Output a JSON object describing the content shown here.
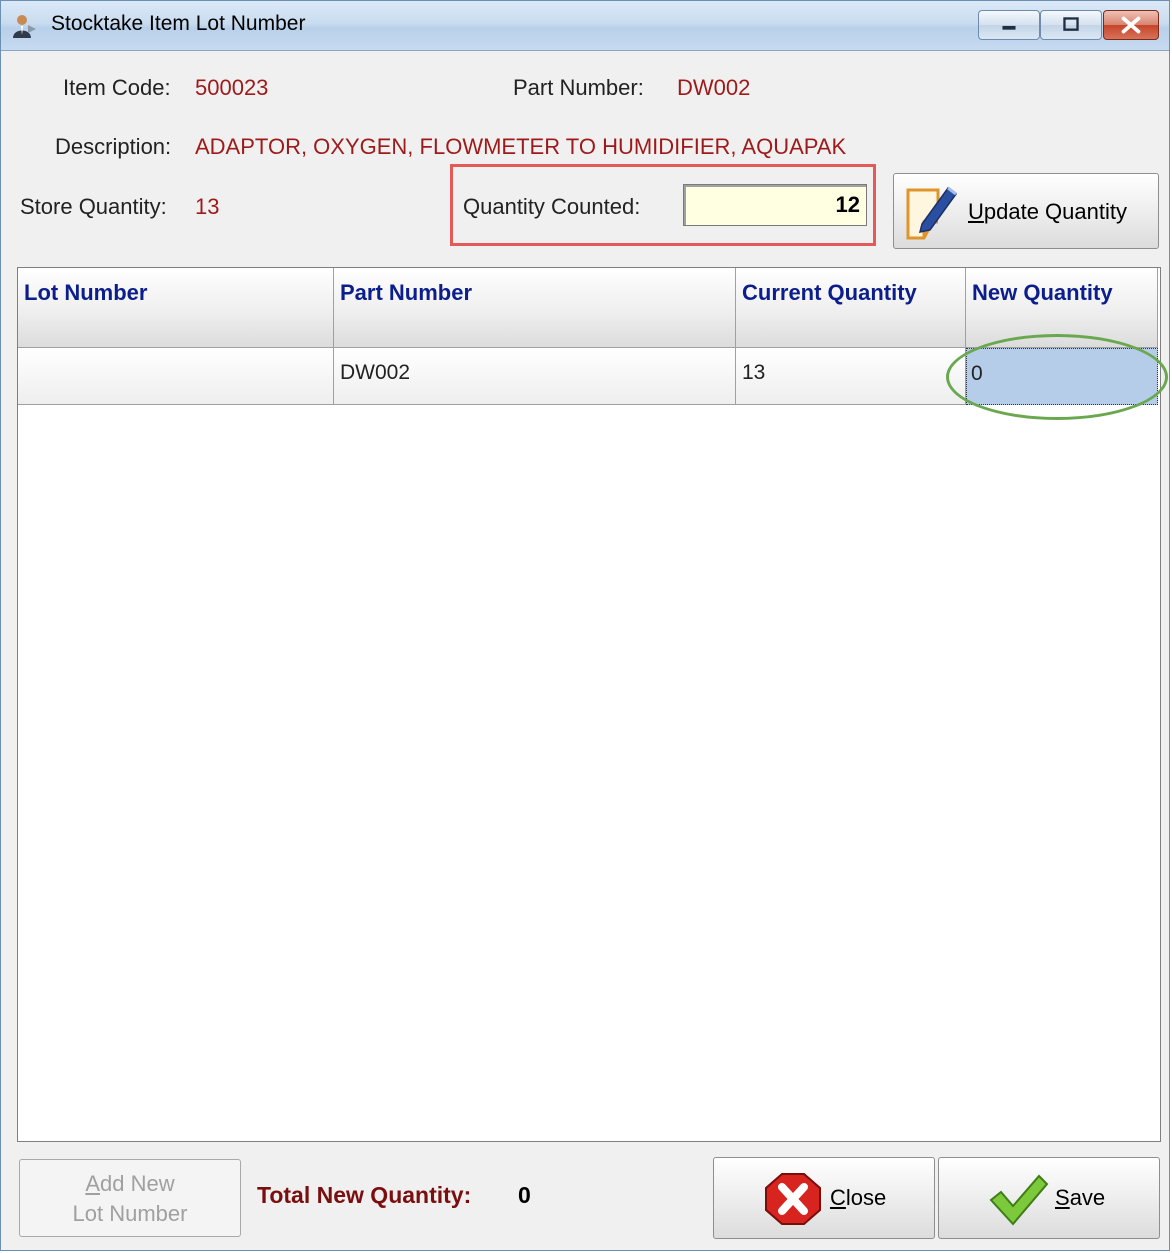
{
  "window": {
    "title": "Stocktake Item Lot Number"
  },
  "details": {
    "item_code_label": "Item Code:",
    "item_code_value": "500023",
    "part_number_label": "Part Number:",
    "part_number_value": "DW002",
    "description_label": "Description:",
    "description_value": "ADAPTOR, OXYGEN, FLOWMETER TO HUMIDIFIER, AQUAPAK",
    "store_quantity_label": "Store Quantity:",
    "store_quantity_value": "13",
    "quantity_counted_label": "Quantity Counted:",
    "quantity_counted_value": "12"
  },
  "update_button": {
    "label_first": "U",
    "label_rest": "pdate Quantity",
    "icon": "edit-note-icon"
  },
  "grid": {
    "columns": [
      "Lot Number",
      "Part Number",
      "Current Quantity",
      "New Quantity"
    ],
    "rows": [
      [
        "",
        "DW002",
        "13",
        "0"
      ]
    ]
  },
  "footer": {
    "add_button_line1_first": "A",
    "add_button_line1_rest": "dd New",
    "add_button_line2": "Lot Number",
    "total_label": "Total New Quantity:",
    "total_value": "0",
    "close_first": "C",
    "close_rest": "lose",
    "save_first": "S",
    "save_rest": "ave"
  },
  "colors": {
    "value_text": "#9e1a1a",
    "header_text": "#0b1e8c",
    "highlight_box": "#e35b59",
    "highlight_oval": "#6aa84f",
    "selected_cell": "#b5cde9"
  }
}
